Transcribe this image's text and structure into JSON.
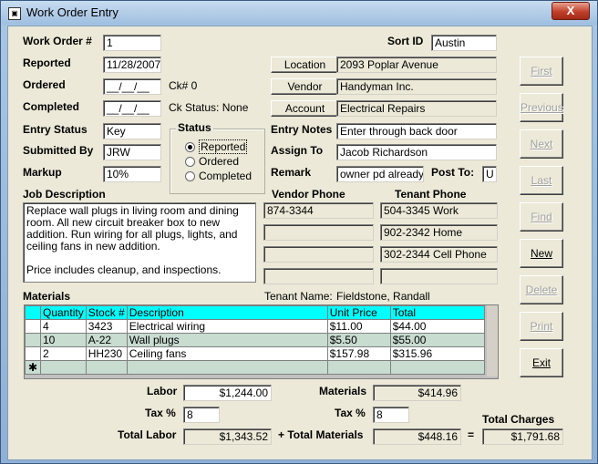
{
  "window": {
    "title": "Work Order Entry",
    "close_glyph": "X"
  },
  "labels": {
    "work_order": "Work Order #",
    "reported": "Reported",
    "ordered": "Ordered",
    "completed": "Completed",
    "entry_status": "Entry Status",
    "submitted_by": "Submitted By",
    "markup": "Markup",
    "job_description": "Job Description",
    "sort_id": "Sort ID",
    "entry_notes": "Entry Notes",
    "assign_to": "Assign To",
    "remark": "Remark",
    "post_to": "Post To:",
    "vendor_phone": "Vendor Phone",
    "tenant_phone": "Tenant Phone",
    "materials": "Materials",
    "tenant_name": "Tenant Name:",
    "labor": "Labor",
    "materials_total": "Materials",
    "tax_pct_1": "Tax %",
    "tax_pct_2": "Tax %",
    "total_labor": "Total Labor",
    "plus_total_materials": "+ Total Materials",
    "equals": "=",
    "total_charges": "Total Charges"
  },
  "fields": {
    "work_order": "1",
    "reported": "11/28/2007",
    "ordered": "__/__/__",
    "completed": "__/__/__",
    "ck_number": "Ck# 0",
    "ck_status": "Ck Status:  None",
    "entry_status": "Key",
    "submitted_by": "JRW",
    "markup": "10%",
    "sort_id": "Austin",
    "location": "2093 Poplar Avenue",
    "vendor": "Handyman Inc.",
    "account": "Electrical Repairs",
    "entry_notes": "Enter through back door",
    "assign_to": "Jacob Richardson",
    "remark": "owner pd already",
    "post_to": "U",
    "job_description": "Replace wall plugs in living room and dining room. All new circuit breaker box to new addition. Run wiring for all plugs, lights, and ceiling fans in new addition.\n\nPrice includes cleanup, and inspections.",
    "tenant_name": "Fieldstone, Randall",
    "vendor_phones": [
      "874-3344",
      "",
      "",
      ""
    ],
    "tenant_phones": [
      "504-3345 Work",
      "902-2342 Home",
      "302-2344 Cell Phone",
      ""
    ]
  },
  "buttons": {
    "location": "Location",
    "vendor": "Vendor",
    "account": "Account"
  },
  "status_group": {
    "title": "Status",
    "options": [
      {
        "label": "Reported",
        "selected": true
      },
      {
        "label": "Ordered",
        "selected": false
      },
      {
        "label": "Completed",
        "selected": false
      }
    ]
  },
  "materials_grid": {
    "columns": [
      "Quantity",
      "Stock #",
      "Description",
      "Unit Price",
      "Total"
    ],
    "rows": [
      [
        "4",
        "3423",
        "Electrical wiring",
        "$11.00",
        "$44.00"
      ],
      [
        "10",
        "A-22",
        "Wall plugs",
        "$5.50",
        "$55.00"
      ],
      [
        "2",
        "HH230",
        "Ceiling fans",
        "$157.98",
        "$315.96"
      ]
    ],
    "new_row_marker": "✱"
  },
  "totals": {
    "labor": "$1,244.00",
    "materials": "$414.96",
    "labor_tax": "8",
    "materials_tax": "8",
    "total_labor": "$1,343.52",
    "total_materials": "$448.16",
    "total_charges": "$1,791.68"
  },
  "nav": [
    {
      "label": "First",
      "enabled": false
    },
    {
      "label": "Previous",
      "enabled": false
    },
    {
      "label": "Next",
      "enabled": false
    },
    {
      "label": "Last",
      "enabled": false
    },
    {
      "label": "Find",
      "enabled": false
    },
    {
      "label": "New",
      "enabled": true
    },
    {
      "label": "Delete",
      "enabled": false
    },
    {
      "label": "Print",
      "enabled": false
    },
    {
      "label": "Exit",
      "enabled": true
    }
  ]
}
